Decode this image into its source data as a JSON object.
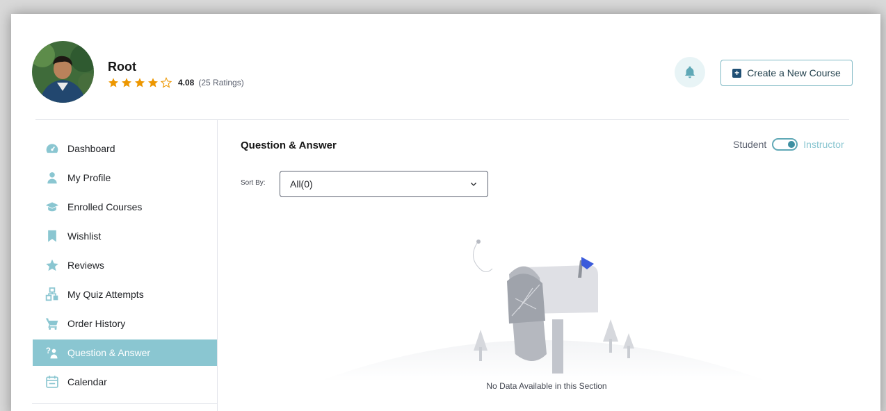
{
  "user": {
    "name": "Root",
    "rating_value": "4.08",
    "rating_count": "(25 Ratings)",
    "stars_filled": 4,
    "stars_total": 5
  },
  "header": {
    "create_course_label": "Create a New Course",
    "bell_icon": "bell-icon"
  },
  "sidebar": {
    "items": [
      {
        "label": "Dashboard",
        "icon": "dashboard-icon",
        "active": false
      },
      {
        "label": "My Profile",
        "icon": "user-icon",
        "active": false
      },
      {
        "label": "Enrolled Courses",
        "icon": "graduation-cap-icon",
        "active": false
      },
      {
        "label": "Wishlist",
        "icon": "bookmark-icon",
        "active": false
      },
      {
        "label": "Reviews",
        "icon": "star-icon",
        "active": false
      },
      {
        "label": "My Quiz Attempts",
        "icon": "quiz-icon",
        "active": false
      },
      {
        "label": "Order History",
        "icon": "cart-icon",
        "active": false
      },
      {
        "label": "Question & Answer",
        "icon": "question-answer-icon",
        "active": true
      },
      {
        "label": "Calendar",
        "icon": "calendar-icon",
        "active": false
      }
    ]
  },
  "main": {
    "title": "Question & Answer",
    "role_student": "Student",
    "role_instructor": "Instructor",
    "sort_label": "Sort By:",
    "sort_value": "All(0)",
    "empty_message": "No Data Available in this Section"
  },
  "colors": {
    "accent": "#8ac6d1",
    "star": "#ed9700",
    "brand_dark": "#1f4f74"
  }
}
